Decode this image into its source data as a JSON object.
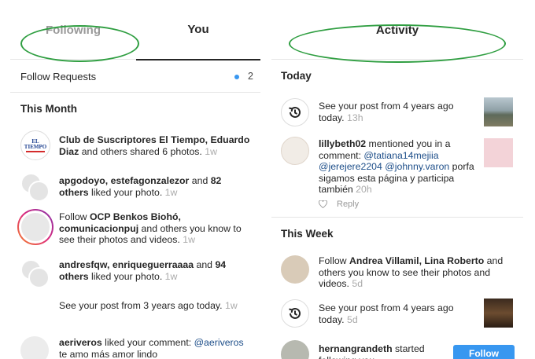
{
  "left_panel": {
    "tabs": {
      "following": "Following",
      "you": "You"
    },
    "follow_requests": {
      "label": "Follow Requests",
      "count": "2"
    },
    "section_this_month": "This Month",
    "items": [
      {
        "bold1": "Club de Suscriptores El Tiempo, Eduardo Diaz",
        "rest": " and others shared 6 photos.",
        "time": " 1w",
        "logo_text": "EL TIEMPO"
      },
      {
        "bold1": "apgodoyo, estefagonzalezor",
        "mid": " and ",
        "bold2": "82 others",
        "rest": " liked your photo.",
        "time": " 1w"
      },
      {
        "pre": "Follow ",
        "bold1": "OCP Benkos Biohó, comunicacionpuj",
        "rest": " and others you know to see their photos and videos.",
        "time": " 1w"
      },
      {
        "bold1": "andresfqw, enriqueguerraaaa",
        "mid": " and ",
        "bold2": "94 others",
        "rest": " liked your photo.",
        "time": " 1w"
      },
      {
        "rest": "See your post from 3 years ago today.",
        "time": " 1w"
      },
      {
        "bold1": "aeriveros",
        "rest": " liked your comment: ",
        "mention": "@aeriveros",
        "rest2": " te amo más amor lindo"
      }
    ]
  },
  "right_panel": {
    "tab_activity": "Activity",
    "section_today": "Today",
    "section_this_week": "This Week",
    "items": [
      {
        "rest": "See your post from 4 years ago today.",
        "time": " 13h"
      },
      {
        "bold1": "lillybeth02",
        "rest": " mentioned you in a comment: ",
        "mention1": "@tatiana14mejiia",
        "space": " ",
        "mention2": "@jerejere2204",
        "space2": " ",
        "mention3": "@johnny.varon",
        "rest2": " porfa sigamos esta página y participa también",
        "time": " 20h",
        "reply": "Reply"
      },
      {
        "pre": "Follow ",
        "bold1": "Andrea Villamil, Lina Roberto",
        "rest": " and others you know to see their photos and videos.",
        "time": " 5d"
      },
      {
        "rest": "See your post from 4 years ago today.",
        "time": " 5d"
      },
      {
        "bold1": "hernangrandeth",
        "rest": " started following you."
      }
    ],
    "follow_button": "Follow"
  },
  "colors": {
    "annotation_green": "#2f9e41",
    "link_blue": "#3897f0",
    "mention": "#1d4e89"
  }
}
